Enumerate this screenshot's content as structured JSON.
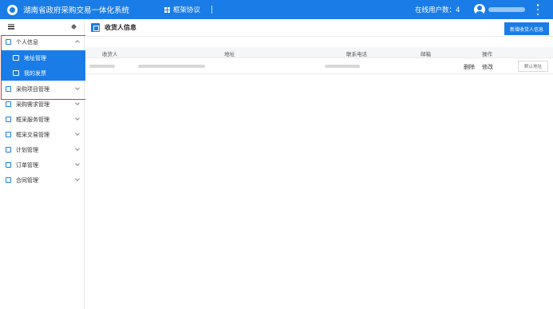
{
  "header": {
    "site_title": "湖南省政府采购交易一体化系统",
    "frame_link": "框架协议",
    "online_users": "在线用户数：4"
  },
  "sidebar": {
    "groups": [
      {
        "label": "个人信息",
        "expanded": true,
        "children": [
          {
            "label": "地址管理",
            "active": true
          },
          {
            "label": "我的发票",
            "active": true
          }
        ]
      },
      {
        "label": "采购项目管理"
      },
      {
        "label": "采购需求管理"
      },
      {
        "label": "框采服务管理"
      },
      {
        "label": "框采交易管理"
      },
      {
        "label": "计划管理"
      },
      {
        "label": "订单管理"
      },
      {
        "label": "合同管理"
      }
    ]
  },
  "main": {
    "title": "收货人信息",
    "add_button": "新增收货人信息",
    "table": {
      "columns": [
        "收货人",
        "地址",
        "联系电话",
        "邮箱",
        "操作"
      ],
      "rows": [
        {
          "actions": [
            "删除",
            "修改"
          ],
          "default_button": "默认地址"
        }
      ]
    }
  },
  "colors": {
    "primary": "#1a7ce6",
    "highlight_border": "#e23434"
  }
}
